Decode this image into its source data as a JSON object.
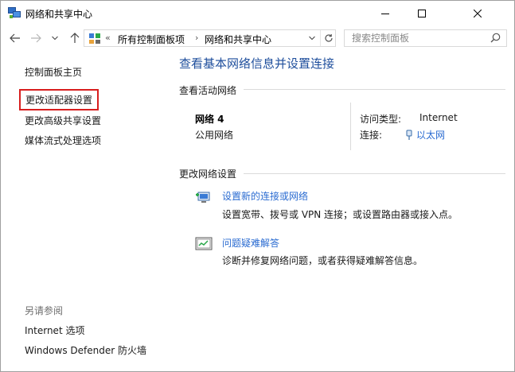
{
  "window": {
    "title": "网络和共享中心",
    "controls": [
      "minimize-icon",
      "maximize-icon",
      "close-icon"
    ]
  },
  "address": {
    "prefix": "«",
    "crumbs": [
      "所有控制面板项",
      "网络和共享中心"
    ],
    "separator": "›"
  },
  "search": {
    "placeholder": "搜索控制面板",
    "value": ""
  },
  "sidebar": {
    "items": [
      {
        "label": "控制面板主页"
      },
      {
        "label": "更改适配器设置",
        "highlighted": true
      },
      {
        "label": "更改高级共享设置"
      },
      {
        "label": "媒体流式处理选项"
      }
    ],
    "see_also": {
      "heading": "另请参阅",
      "items": [
        {
          "label": "Internet 选项"
        },
        {
          "label": "Windows Defender 防火墙"
        }
      ]
    }
  },
  "main": {
    "title": "查看基本网络信息并设置连接",
    "active_section": "查看活动网络",
    "network": {
      "name": "网络 4",
      "category": "公用网络",
      "access_type_label": "访问类型:",
      "access_type_value": "Internet",
      "connection_label": "连接:",
      "connection_value": "以太网"
    },
    "change_section": "更改网络设置",
    "tasks": [
      {
        "title": "设置新的连接或网络",
        "desc": "设置宽带、拨号或 VPN 连接；或设置路由器或接入点。",
        "icon": "network-setup-icon"
      },
      {
        "title": "问题疑难解答",
        "desc": "诊断并修复网络问题，或者获得疑难解答信息。",
        "icon": "troubleshoot-icon"
      }
    ]
  },
  "colors": {
    "link": "#2a6bd1",
    "heading": "#1e4e9c",
    "highlight_border": "#d81e1e"
  }
}
